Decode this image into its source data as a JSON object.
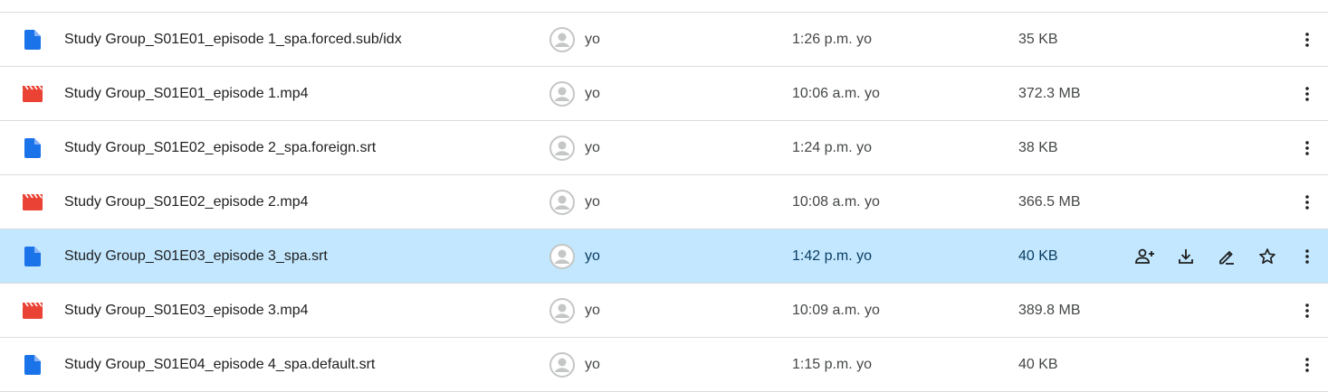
{
  "colors": {
    "doc_icon": "#1a73e8",
    "video_icon": "#ea4335",
    "selected_row": "#c2e7ff",
    "divider": "#dadce0",
    "avatar": "#c4c7c5"
  },
  "row_actions": [
    {
      "icon": "add-person-icon"
    },
    {
      "icon": "download-icon"
    },
    {
      "icon": "rename-pencil-icon"
    },
    {
      "icon": "star-icon"
    }
  ],
  "files": [
    {
      "icon": "doc-icon",
      "name": "Study Group_S01E01_episode 1_spa.forced.sub/idx",
      "owner": "yo",
      "modified": "1:26 p.m. yo",
      "size": "35 KB",
      "selected": false
    },
    {
      "icon": "video-icon",
      "name": "Study Group_S01E01_episode 1.mp4",
      "owner": "yo",
      "modified": "10:06 a.m. yo",
      "size": "372.3 MB",
      "selected": false
    },
    {
      "icon": "doc-icon",
      "name": "Study Group_S01E02_episode 2_spa.foreign.srt",
      "owner": "yo",
      "modified": "1:24 p.m. yo",
      "size": "38 KB",
      "selected": false
    },
    {
      "icon": "video-icon",
      "name": "Study Group_S01E02_episode 2.mp4",
      "owner": "yo",
      "modified": "10:08 a.m. yo",
      "size": "366.5 MB",
      "selected": false
    },
    {
      "icon": "doc-icon",
      "name": "Study Group_S01E03_episode 3_spa.srt",
      "owner": "yo",
      "modified": "1:42 p.m. yo",
      "size": "40 KB",
      "selected": true
    },
    {
      "icon": "video-icon",
      "name": "Study Group_S01E03_episode 3.mp4",
      "owner": "yo",
      "modified": "10:09 a.m. yo",
      "size": "389.8 MB",
      "selected": false
    },
    {
      "icon": "doc-icon",
      "name": "Study Group_S01E04_episode 4_spa.default.srt",
      "owner": "yo",
      "modified": "1:15 p.m. yo",
      "size": "40 KB",
      "selected": false
    }
  ]
}
